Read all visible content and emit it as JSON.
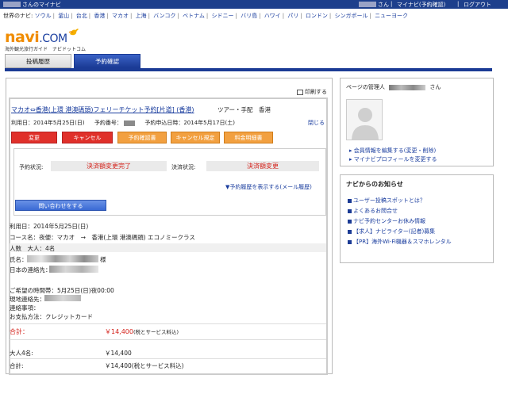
{
  "header": {
    "user_suffix": "さんのマイナビ",
    "user_suffix2": "さん",
    "links": [
      "マイナビ(予約確認)",
      "ログアウト"
    ],
    "separator": "|"
  },
  "city_nav": {
    "label": "世界のナビ:",
    "cities": [
      "ソウル",
      "釜山",
      "台北",
      "香港",
      "マカオ",
      "上海",
      "バンコク",
      "ベトナム",
      "シドニー",
      "バリ島",
      "ハワイ",
      "パリ",
      "ロンドン",
      "シンガポール",
      "ニューヨーク"
    ]
  },
  "logo": {
    "main": "navi",
    "suffix": ".COM",
    "tagline": "海外観光旅行ガイド　ナビドットコム"
  },
  "tabs": [
    {
      "label": "投稿履歴"
    },
    {
      "label": "予約確認"
    }
  ],
  "main": {
    "print_label": "印刷する",
    "route_title": "マカオ⇔香港(上環 港澳碼頭)フェリーチケット予約[片道] (香港)",
    "route_sub": "ツアー・手配　香港",
    "use_date_label": "利用日：2014年5月25日(日)",
    "booking_no_label": "予約番号：",
    "apply_date_label": "予約申込日時：2014年5月17日(土)",
    "close_label": "閉じる",
    "buttons": [
      "変更",
      "キャンセル",
      "予約確認書",
      "キャンセル規定",
      "料金明細書"
    ],
    "status_label": "予約状況:",
    "status_value": "決済額変更完了",
    "payment_label": "決済状況:",
    "payment_value": "決済額変更",
    "history_link": "▼予約履歴を表示する(メール履歴)",
    "contact_button": "問い合わせをする",
    "detail_use_date": "利用日：2014年5月25日(日)",
    "course": "コース名：夜便：マカオ　→　香港(上環 港澳碼頭) エコノミークラス",
    "people_header": "人数　大人：4名",
    "name_label": "氏名：",
    "name_suffix": "様",
    "japan_contact_label": "日本の連絡先：",
    "desired_time": "ご希望の時間帯：5月25日(日)夜00:00",
    "local_contact_label": "現地連絡先：",
    "notes_label": "連絡事項：",
    "payment_method": "お支払方法：クレジットカード",
    "total_label": "合計：",
    "total_value": "￥14,400",
    "total_note": "(税とサービス料込)",
    "adult_label": "大人4名:",
    "adult_value": "￥14,400",
    "total2_label": "合計:",
    "total2_value": "￥14,400(税とサービス料込)"
  },
  "admin": {
    "label": "ページの管理人",
    "suffix": "さん",
    "links": [
      "会員情報を編集する(変更・削除)",
      "マイナビプロフィールを変更する"
    ]
  },
  "news": {
    "title": "ナビからのお知らせ",
    "items": [
      "ユーザー投稿スポットとは？",
      "よくあるお問合せ",
      "ナビ予約センターお休み情報",
      "【求人】ナビライター(記者)募集",
      "【PR】海外Wi-Fi機器＆スマホレンタル"
    ]
  },
  "colors": {
    "accent": "#1b3b95",
    "alert": "#d4221b",
    "logo_orange": "#f08c00"
  }
}
